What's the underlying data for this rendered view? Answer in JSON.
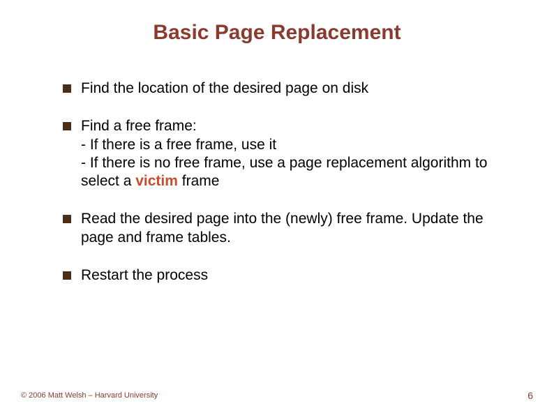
{
  "title": "Basic Page Replacement",
  "bullets": {
    "b1": "Find the location of the desired page on disk",
    "b2_head": "Find a free frame:",
    "b2_sub1": "- If there is a free frame, use it",
    "b2_sub2_pre": "- If there is no free frame, use a page replacement algorithm to select a ",
    "b2_sub2_victim": "victim",
    "b2_sub2_post": " frame",
    "b3": "Read the desired page into the (newly) free frame. Update the page and frame tables.",
    "b4": "Restart the process"
  },
  "footer": {
    "copyright": "© 2006 Matt Welsh – Harvard University",
    "page": "6"
  }
}
